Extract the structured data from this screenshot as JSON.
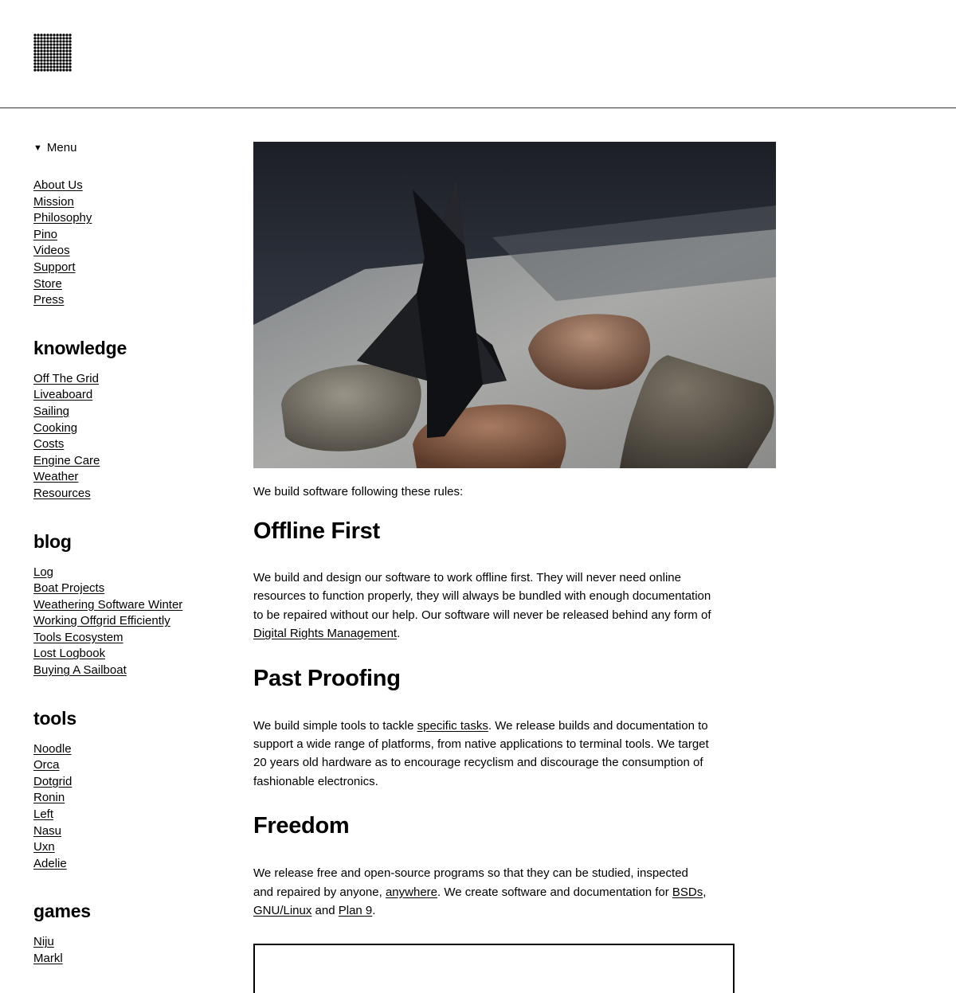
{
  "header": {
    "logo": "dot-grid-logo-icon"
  },
  "sidebar": {
    "menu_label": "Menu",
    "main_links": [
      "About Us",
      "Mission",
      "Philosophy",
      "Pino",
      "Videos",
      "Support",
      "Store",
      "Press"
    ],
    "sections": [
      {
        "title": "knowledge",
        "links": [
          "Off The Grid",
          "Liveaboard",
          "Sailing",
          "Cooking",
          "Costs",
          "Engine Care",
          "Weather",
          "Resources"
        ]
      },
      {
        "title": "blog",
        "links": [
          "Log",
          "Boat Projects",
          "Weathering Software Winter",
          "Working Offgrid Efficiently",
          "Tools Ecosystem",
          "Lost Logbook",
          "Buying A Sailboat"
        ]
      },
      {
        "title": "tools",
        "links": [
          "Noodle",
          "Orca",
          "Dotgrid",
          "Ronin",
          "Left",
          "Nasu",
          "Uxn",
          "Adelie"
        ]
      },
      {
        "title": "games",
        "links": [
          "Niju",
          "Markl"
        ]
      }
    ]
  },
  "main": {
    "hero_alt": "origami-rabbit-photo",
    "intro": "We build software following these rules:",
    "offline": {
      "title": "Offline First",
      "text_1": "We build and design our software to work offline first. They will never need online resources to function properly, they will always be bundled with enough documentation to be repaired without our help. Our software will never be released behind any form of ",
      "link_1": "Digital Rights Management",
      "text_2": "."
    },
    "past": {
      "title": "Past Proofing",
      "text_1": "We build simple tools to tackle ",
      "link_1": "specific tasks",
      "text_2": ". We release builds and documentation to support a wide range of platforms, from native applications to terminal tools. We target 20 years old hardware as to encourage recyclism and discourage the consumption of fashionable electronics."
    },
    "freedom": {
      "title": "Freedom",
      "text_1": "We release free and open-source programs so that they can be studied, inspected and repaired by anyone, ",
      "link_1": "anywhere",
      "text_2": ". We create software and documentation for ",
      "link_2": "BSDs",
      "text_3": ", ",
      "link_3": "GNU/Linux",
      "text_4": " and ",
      "link_4": "Plan 9",
      "text_5": "."
    }
  }
}
